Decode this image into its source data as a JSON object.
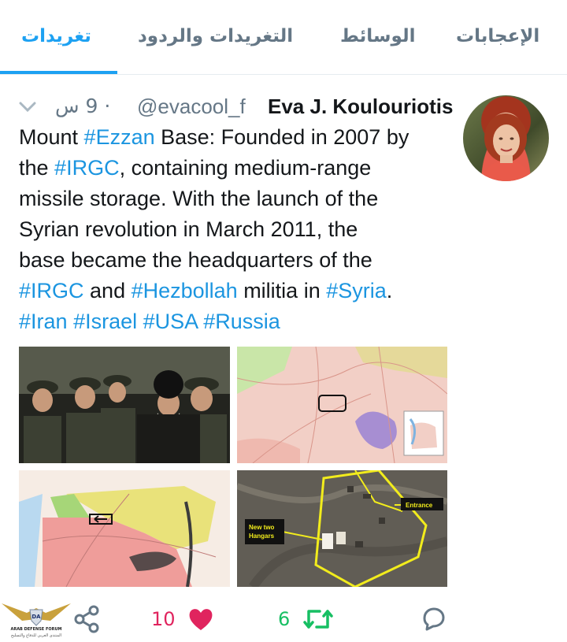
{
  "tabs": [
    {
      "label": "الإعجابات"
    },
    {
      "label": "الوسائط"
    },
    {
      "label": "التغريدات والردود"
    },
    {
      "label": "تغريدات"
    }
  ],
  "tweet": {
    "author_name": "Eva J. Koulouriotis",
    "handle": "@evacool_f",
    "time": "· 9 س",
    "text_lines": [
      [
        {
          "t": "Mount "
        },
        {
          "t": "#Ezzan",
          "tag": true
        },
        {
          "t": " Base: Founded in 2007 by"
        }
      ],
      [
        {
          "t": "the "
        },
        {
          "t": "#IRGC",
          "tag": true
        },
        {
          "t": ", containing medium-range"
        }
      ],
      [
        {
          "t": "missile storage. With the launch of the"
        }
      ],
      [
        {
          "t": "Syrian revolution in March 2011, the"
        }
      ],
      [
        {
          "t": "base became the headquarters of the"
        }
      ],
      [
        {
          "t": "#IRGC",
          "tag": true
        },
        {
          "t": " and "
        },
        {
          "t": "#Hezbollah",
          "tag": true
        },
        {
          "t": " militia in "
        },
        {
          "t": "#Syria",
          "tag": true
        },
        {
          "t": "."
        }
      ],
      [
        {
          "t": "#Iran",
          "tag": true
        },
        {
          "t": " "
        },
        {
          "t": "#Israel",
          "tag": true
        },
        {
          "t": " "
        },
        {
          "t": "#USA",
          "tag": true
        },
        {
          "t": " "
        },
        {
          "t": "#Russia",
          "tag": true
        }
      ]
    ],
    "media": {
      "satellite_labels": [
        "New two",
        "Hangars",
        "Entrance"
      ]
    },
    "likes_count": "10",
    "retweets_count": "6"
  },
  "watermark": {
    "initials": "DA",
    "text": "ARAB DEFENSE FORUM",
    "subtext": "المنتدى العربي للدفاع والتسليح"
  },
  "colors": {
    "accent": "#1da1f2",
    "hashtag": "#1b95e0",
    "like": "#e0245e",
    "retweet": "#17bf63",
    "muted": "#657786"
  },
  "icons": [
    "chevron-down-icon",
    "share-icon",
    "heart-icon",
    "retweet-icon",
    "reply-icon"
  ]
}
